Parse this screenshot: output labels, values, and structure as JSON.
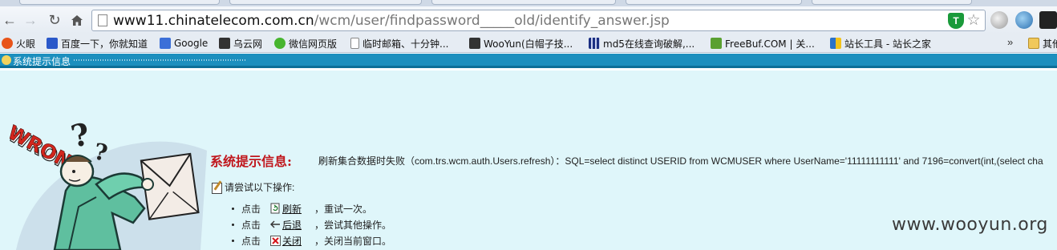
{
  "browser": {
    "address": {
      "host": "www11.chinatelecom.com.cn",
      "path": "/wcm/user/findpassword_____old/identify_answer.jsp"
    },
    "bookmarks": [
      {
        "label": "火眼",
        "icon": "huoyan-icon"
      },
      {
        "label": "百度一下，你就知道",
        "icon": "baidu-icon"
      },
      {
        "label": "Google",
        "icon": "google-icon"
      },
      {
        "label": "乌云网",
        "icon": "wooyun-icon"
      },
      {
        "label": "微信网页版",
        "icon": "wechat-icon"
      },
      {
        "label": "临时邮箱、十分钟...",
        "icon": "page-icon"
      },
      {
        "label": "WooYun(白帽子技...",
        "icon": "wooyun-icon"
      },
      {
        "label": "md5在线查询破解,...",
        "icon": "md5-icon"
      },
      {
        "label": "FreeBuf.COM | 关...",
        "icon": "freebuf-icon"
      },
      {
        "label": "站长工具 - 站长之家",
        "icon": "chinaz-icon"
      },
      {
        "label": "其他",
        "icon": "folder-icon"
      }
    ],
    "more_glyph": "»"
  },
  "page": {
    "titlebar_text": "系统提示信息",
    "error_title": "系统提示信息:",
    "error_message": "刷新集合数据时失败（com.trs.wcm.auth.Users.refresh）：SQL=select distinct USERID from WCMUSER where UserName='11111111111' and 7196=convert(int,(select cha",
    "hint": "请尝试以下操作:",
    "actions": [
      {
        "prefix": "点击",
        "link": "刷新",
        "suffix": "，重试一次。",
        "icon": "refresh-icon"
      },
      {
        "prefix": "点击",
        "link": "后退",
        "suffix": "，尝试其他操作。",
        "icon": "back-arrow-icon"
      },
      {
        "prefix": "点击",
        "link": "关闭",
        "suffix": "，关闭当前窗口。",
        "icon": "close-window-icon"
      }
    ],
    "illustration_text": "WRONG!",
    "watermark": "www.wooyun.org"
  },
  "colors": {
    "titlebar": "#1c8fbe",
    "content_bg": "#dff6fa",
    "error_title": "#c0161c"
  }
}
